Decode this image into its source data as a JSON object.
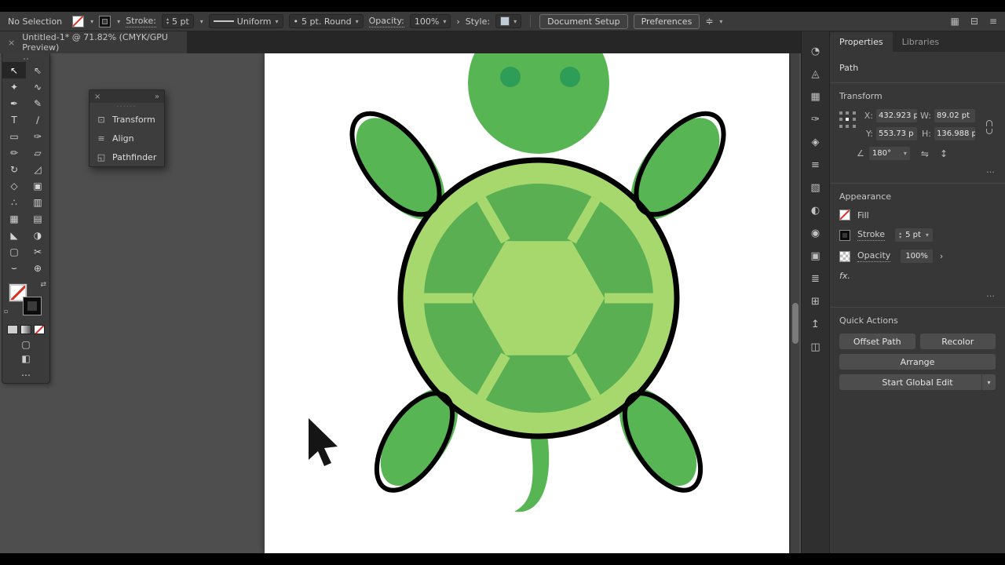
{
  "glyphs": {
    "close": "×",
    "expand": "»",
    "more": "…",
    "chevron": "▾",
    "up": "▴",
    "down": "▾",
    "gt": "›",
    "angle": "∠",
    "flip_h": "⇋",
    "flip_v": "↕",
    "bullet": "•",
    "swap": "⇄",
    "mini": "▫"
  },
  "control_bar": {
    "selection_status": "No Selection",
    "stroke_label": "Stroke:",
    "stroke_value": "5 pt",
    "width_profile": "Uniform",
    "brush": "5 pt. Round",
    "opacity_label": "Opacity:",
    "opacity_value": "100%",
    "style_label": "Style:",
    "document_setup_label": "Document Setup",
    "preferences_label": "Preferences",
    "right_icons": [
      {
        "name": "grid-view-icon",
        "glyph": "▦"
      },
      {
        "name": "arrange-documents-icon",
        "glyph": "⊟"
      },
      {
        "name": "workspace-menu-icon",
        "glyph": "≡"
      }
    ]
  },
  "document_tab": {
    "title": "Untitled-1* @ 71.82% (CMYK/GPU Preview)"
  },
  "toolbar": {
    "tools": [
      {
        "name": "selection-tool",
        "glyph": "↖",
        "selected": true
      },
      {
        "name": "direct-selection-tool",
        "glyph": "⇖"
      },
      {
        "name": "magic-wand-tool",
        "glyph": "✦"
      },
      {
        "name": "lasso-tool",
        "glyph": "∿"
      },
      {
        "name": "pen-tool",
        "glyph": "✒"
      },
      {
        "name": "curvature-tool",
        "glyph": "✎"
      },
      {
        "name": "type-tool",
        "glyph": "T"
      },
      {
        "name": "line-segment-tool",
        "glyph": "∕"
      },
      {
        "name": "rectangle-tool",
        "glyph": "▭"
      },
      {
        "name": "paintbrush-tool",
        "glyph": "✑"
      },
      {
        "name": "pencil-tool",
        "glyph": "✏"
      },
      {
        "name": "shaper-tool",
        "glyph": "▱"
      },
      {
        "name": "rotate-tool",
        "glyph": "↻"
      },
      {
        "name": "scale-tool",
        "glyph": "◿"
      },
      {
        "name": "width-tool",
        "glyph": "◇"
      },
      {
        "name": "free-transform-tool",
        "glyph": "▣"
      },
      {
        "name": "symbol-sprayer-tool",
        "glyph": "∴"
      },
      {
        "name": "graph-tool",
        "glyph": "▥"
      },
      {
        "name": "mesh-tool",
        "glyph": "▦"
      },
      {
        "name": "gradient-tool",
        "glyph": "▤"
      },
      {
        "name": "eyedropper-tool",
        "glyph": "◣"
      },
      {
        "name": "blend-tool",
        "glyph": "◑"
      },
      {
        "name": "artboard-tool",
        "glyph": "▢"
      },
      {
        "name": "slice-tool",
        "glyph": "✂"
      },
      {
        "name": "hand-tool",
        "glyph": "⌣"
      },
      {
        "name": "zoom-tool",
        "glyph": "⊕"
      }
    ]
  },
  "floating_panel": {
    "items": [
      {
        "name": "transform",
        "label": "Transform",
        "glyph": "⊡"
      },
      {
        "name": "align",
        "label": "Align",
        "glyph": "≡"
      },
      {
        "name": "pathfinder",
        "label": "Pathfinder",
        "glyph": "◱"
      }
    ]
  },
  "dock_icons": [
    {
      "name": "color-panel-icon",
      "glyph": "◔"
    },
    {
      "name": "color-guide-panel-icon",
      "glyph": "◬"
    },
    {
      "name": "swatches-panel-icon",
      "glyph": "▦"
    },
    {
      "name": "brushes-panel-icon",
      "glyph": "✑"
    },
    {
      "name": "symbols-panel-icon",
      "glyph": "◈"
    },
    {
      "name": "stroke-panel-icon",
      "glyph": "≡"
    },
    {
      "name": "gradient-panel-icon",
      "glyph": "▧"
    },
    {
      "name": "transparency-panel-icon",
      "glyph": "◐"
    },
    {
      "name": "appearance-panel-icon",
      "glyph": "◉"
    },
    {
      "name": "graphic-styles-panel-icon",
      "glyph": "▣"
    },
    {
      "name": "layers-panel-icon",
      "glyph": "≣"
    },
    {
      "name": "artboards-panel-icon",
      "glyph": "⊞"
    },
    {
      "name": "asset-export-panel-icon",
      "glyph": "↥"
    },
    {
      "name": "libraries-panel-icon",
      "glyph": "◫"
    }
  ],
  "properties_panel": {
    "tabs": [
      "Properties",
      "Libraries"
    ],
    "selection_type": "Path",
    "transform": {
      "title": "Transform",
      "x_label": "X:",
      "x_value": "432.923 p",
      "y_label": "Y:",
      "y_value": "553.73 p",
      "w_label": "W:",
      "w_value": "89.02 pt",
      "h_label": "H:",
      "h_value": "136.988 p",
      "angle_value": "180°"
    },
    "appearance": {
      "title": "Appearance",
      "fill_label": "Fill",
      "stroke_label": "Stroke",
      "stroke_value": "5 pt",
      "opacity_label": "Opacity",
      "opacity_value": "100%",
      "fx_label": "fx."
    },
    "quick_actions": {
      "title": "Quick Actions",
      "buttons": [
        {
          "label": "Offset Path"
        },
        {
          "label": "Recolor"
        },
        {
          "label": "Arrange"
        },
        {
          "label": "Start Global Edit",
          "has_menu": true
        }
      ]
    }
  },
  "artwork": {
    "colors": {
      "body": "#57b554",
      "shell_ring": "#a6d86d",
      "shell_segments": "#5aaf53",
      "eye": "#2d9d57",
      "outline": "#000000"
    }
  }
}
